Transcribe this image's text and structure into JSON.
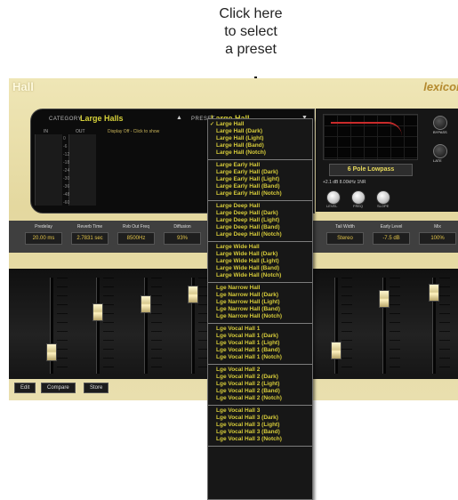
{
  "callout": {
    "lines": [
      "Click here",
      "to select",
      "a preset"
    ]
  },
  "plugin": {
    "name": "Hall",
    "brand": "lexicon",
    "category_label": "CATEGORY",
    "category_value": "Large Halls",
    "preset_label": "PRESET",
    "preset_value": "Large Hall",
    "meter_heads": [
      "IN",
      "OUT"
    ],
    "meter_ticks": [
      "0",
      "-6",
      "-12",
      "-18",
      "-24",
      "-30",
      "-36",
      "-48",
      "-60"
    ],
    "display_text": "Display Off - Click to show"
  },
  "eq": {
    "filter_mode": "6 Pole Lowpass",
    "knob_values": "+2.1 dB  8.00kHz  1NR",
    "knob_labels": [
      "LEVEL",
      "FREQ",
      "SLOPE"
    ],
    "side_labels": [
      "BYPASS",
      "LATE"
    ]
  },
  "params": [
    {
      "name": "Predelay",
      "value": "20.00 ms"
    },
    {
      "name": "Reverb Time",
      "value": "2.7831 sec"
    },
    {
      "name": "Rvb Out Freq",
      "value": "8500Hz"
    },
    {
      "name": "Diffusion",
      "value": "93%"
    },
    {
      "name": "Tail Width",
      "value": "Stereo"
    },
    {
      "name": "Early Level",
      "value": "-7.5 dB"
    },
    {
      "name": "Mix",
      "value": "100%"
    }
  ],
  "faders": {
    "levels": [
      0.18,
      0.68,
      0.78,
      0.9,
      0.2,
      0.84,
      0.92
    ]
  },
  "toolbar": {
    "buttons": [
      "Edit",
      "Compare",
      "Store"
    ]
  },
  "menu": {
    "selected": "Large Hall",
    "groups": [
      [
        "Large Hall",
        "Large Hall (Dark)",
        "Large Hall (Light)",
        "Large Hall (Band)",
        "Large Hall (Notch)"
      ],
      [
        "Large Early Hall",
        "Large Early Hall (Dark)",
        "Large Early Hall (Light)",
        "Large Early Hall (Band)",
        "Large Early Hall (Notch)"
      ],
      [
        "Large Deep Hall",
        "Large Deep Hall (Dark)",
        "Large Deep Hall (Light)",
        "Large Deep Hall (Band)",
        "Large Deep Hall (Notch)"
      ],
      [
        "Large Wide Hall",
        "Large Wide Hall (Dark)",
        "Large Wide Hall (Light)",
        "Large Wide Hall (Band)",
        "Large Wide Hall (Notch)"
      ],
      [
        "Lge Narrow Hall",
        "Lge Narrow Hall (Dark)",
        "Lge Narrow Hall (Light)",
        "Lge Narrow Hall (Band)",
        "Lge Narrow Hall (Notch)"
      ],
      [
        "Lge Vocal Hall 1",
        "Lge Vocal Hall 1 (Dark)",
        "Lge Vocal Hall 1 (Light)",
        "Lge Vocal Hall 1 (Band)",
        "Lge Vocal Hall 1 (Notch)"
      ],
      [
        "Lge Vocal Hall 2",
        "Lge Vocal Hall 2 (Dark)",
        "Lge Vocal Hall 2 (Light)",
        "Lge Vocal Hall 2 (Band)",
        "Lge Vocal Hall 2 (Notch)"
      ],
      [
        "Lge Vocal Hall 3",
        "Lge Vocal Hall 3 (Dark)",
        "Lge Vocal Hall 3 (Light)",
        "Lge Vocal Hall 3 (Band)",
        "Lge Vocal Hall 3 (Notch)"
      ]
    ]
  }
}
